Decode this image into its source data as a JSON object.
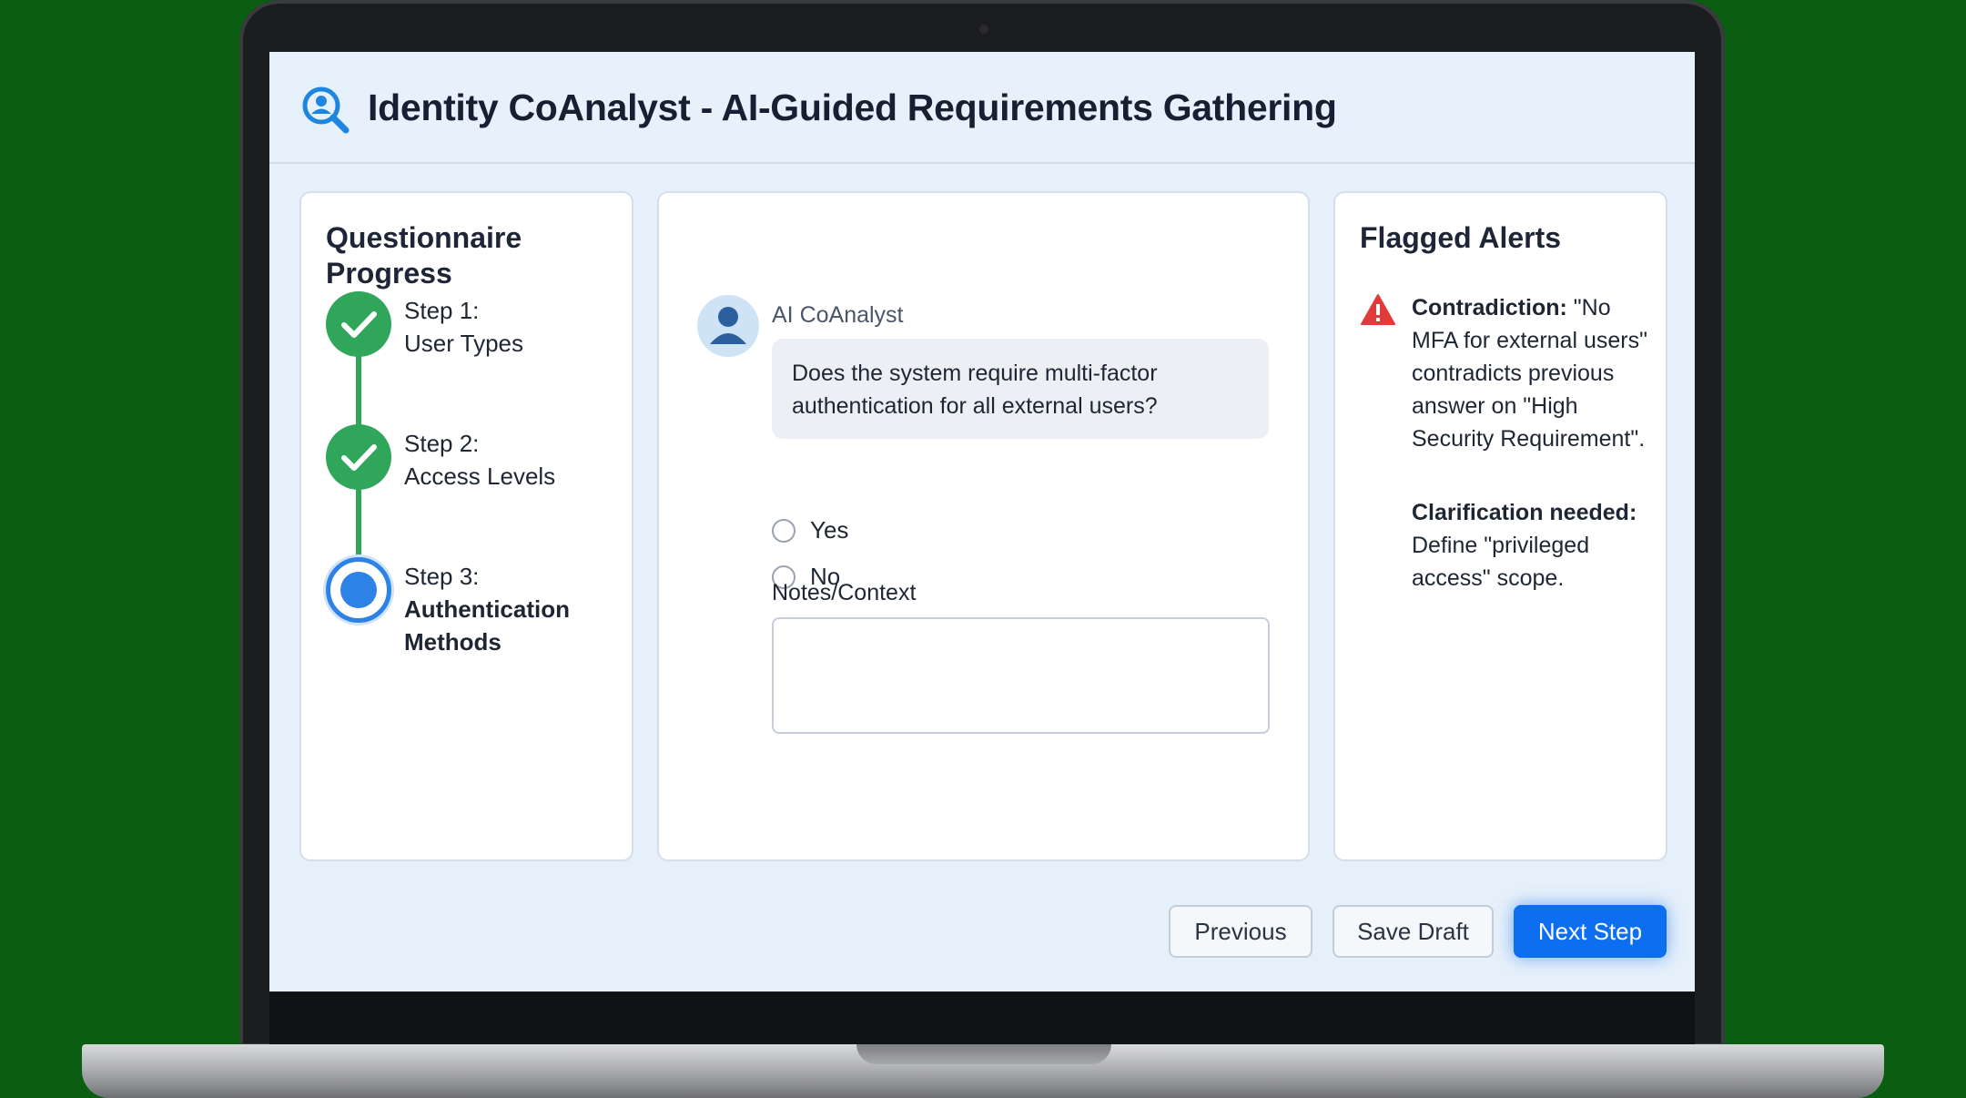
{
  "header": {
    "title": "Identity CoAnalyst - AI-Guided Requirements Gathering",
    "logo_icon": "search-user-icon"
  },
  "progress": {
    "title": "Questionnaire Progress",
    "steps": [
      {
        "number": "Step 1:",
        "label": "User Types",
        "status": "completed"
      },
      {
        "number": "Step 2:",
        "label": "Access Levels",
        "status": "completed"
      },
      {
        "number": "Step 3:",
        "label": "Authentication Methods",
        "status": "current"
      }
    ]
  },
  "chat": {
    "sender": "AI CoAnalyst",
    "question": "Does the system require multi-factor authentication for all external users?",
    "options": [
      "Yes",
      "No"
    ],
    "selected": null,
    "notes_label": "Notes/Context",
    "notes_value": ""
  },
  "alerts": {
    "title": "Flagged Alerts",
    "contradiction_label": "Contradiction:",
    "contradiction_text": "\"No MFA for external users\" contradicts previous answer on \"High Security Requirement\".",
    "clarification_label": "Clarification needed:",
    "clarification_text": "Define \"privileged access\" scope."
  },
  "actions": {
    "previous": "Previous",
    "save_draft": "Save Draft",
    "next_step": "Next Step"
  },
  "colors": {
    "accent": "#0d6ef0",
    "success": "#2fa65a",
    "alert": "#e03a3a",
    "background": "#0b5d12"
  }
}
